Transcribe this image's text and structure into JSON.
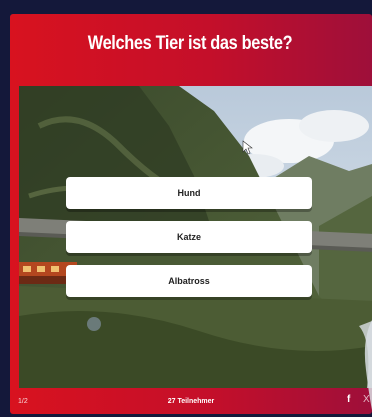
{
  "quiz": {
    "question": "Welches Tier ist das beste?",
    "answers": [
      {
        "label": "Hund"
      },
      {
        "label": "Katze"
      },
      {
        "label": "Albatross"
      }
    ]
  },
  "footer": {
    "progress": "1/2",
    "participants": "27 Teilnehmer",
    "share_facebook_glyph": "f",
    "share_x_glyph": "X"
  },
  "colors": {
    "card_red": "#d8121f",
    "card_red_dark": "#9e0f3a",
    "frame_navy": "#14183a"
  },
  "icons": [
    "facebook-icon",
    "x-icon",
    "mouse-cursor-icon"
  ]
}
